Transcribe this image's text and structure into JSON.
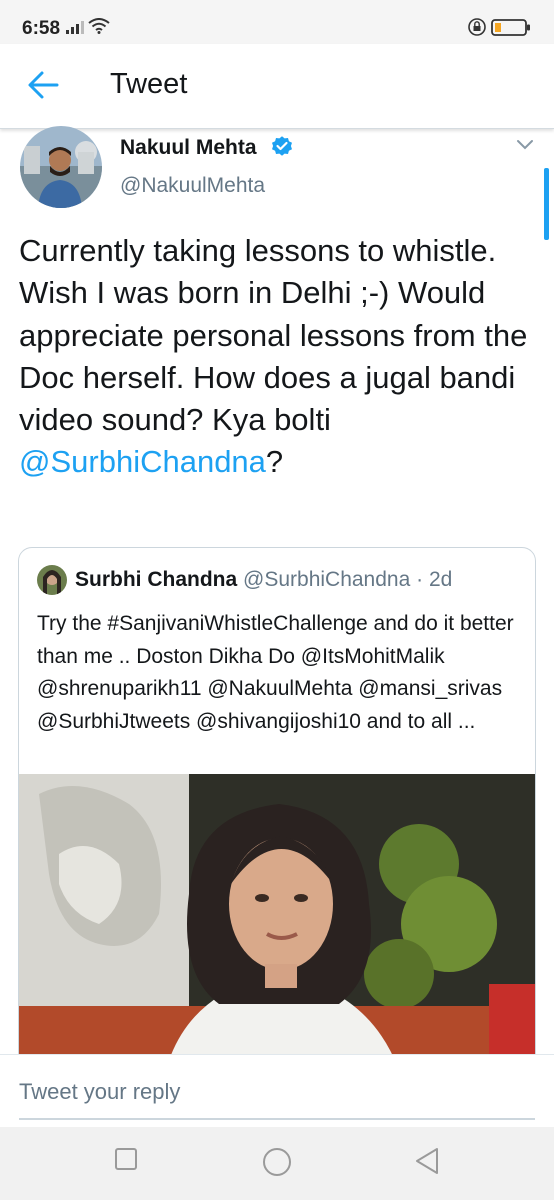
{
  "status_bar": {
    "time": "6:58",
    "icons": [
      "signal-icon",
      "wifi-icon",
      "lock-icon",
      "battery-icon"
    ]
  },
  "header": {
    "title": "Tweet",
    "back_icon": "arrow-left-icon"
  },
  "tweet": {
    "author_name": "Nakuul Mehta",
    "author_handle": "@NakuulMehta",
    "verified": true,
    "text_main": "Currently taking lessons to whistle. Wish I was born in Delhi ;-) Would appreciate personal lessons from the Doc herself. How does a jugal bandi video sound? Kya bolti ",
    "text_mention": "@SurbhiChandna",
    "text_end": "?"
  },
  "quoted_tweet": {
    "author_name": "Surbhi Chandna",
    "author_handle": "@SurbhiChandna",
    "time": "· 2d",
    "text": "Try the #SanjivaniWhistleChallenge and do it better than me .. Doston Dikha Do @ItsMohitMalik @shrenuparikh11 @NakuulMehta @mansi_srivas @SurbhiJtweets @shivangijoshi10 and to all ..."
  },
  "reply": {
    "placeholder": "Tweet your reply"
  },
  "colors": {
    "accent": "#1da1f2",
    "text": "#14171a",
    "secondary": "#657786",
    "border": "#ccd6dd"
  }
}
